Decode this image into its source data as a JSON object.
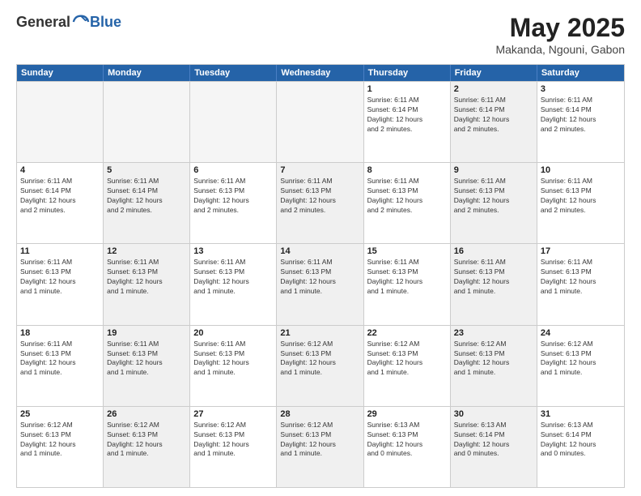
{
  "header": {
    "logo": {
      "general": "General",
      "blue": "Blue"
    },
    "title": "May 2025",
    "location": "Makanda, Ngouni, Gabon"
  },
  "calendar": {
    "days_of_week": [
      "Sunday",
      "Monday",
      "Tuesday",
      "Wednesday",
      "Thursday",
      "Friday",
      "Saturday"
    ],
    "rows": [
      [
        {
          "day": "",
          "empty": true
        },
        {
          "day": "",
          "empty": true
        },
        {
          "day": "",
          "empty": true
        },
        {
          "day": "",
          "empty": true
        },
        {
          "day": "1",
          "info": "Sunrise: 6:11 AM\nSunset: 6:14 PM\nDaylight: 12 hours\nand 2 minutes."
        },
        {
          "day": "2",
          "info": "Sunrise: 6:11 AM\nSunset: 6:14 PM\nDaylight: 12 hours\nand 2 minutes.",
          "shaded": true
        },
        {
          "day": "3",
          "info": "Sunrise: 6:11 AM\nSunset: 6:14 PM\nDaylight: 12 hours\nand 2 minutes."
        }
      ],
      [
        {
          "day": "4",
          "info": "Sunrise: 6:11 AM\nSunset: 6:14 PM\nDaylight: 12 hours\nand 2 minutes."
        },
        {
          "day": "5",
          "info": "Sunrise: 6:11 AM\nSunset: 6:14 PM\nDaylight: 12 hours\nand 2 minutes.",
          "shaded": true
        },
        {
          "day": "6",
          "info": "Sunrise: 6:11 AM\nSunset: 6:13 PM\nDaylight: 12 hours\nand 2 minutes."
        },
        {
          "day": "7",
          "info": "Sunrise: 6:11 AM\nSunset: 6:13 PM\nDaylight: 12 hours\nand 2 minutes.",
          "shaded": true
        },
        {
          "day": "8",
          "info": "Sunrise: 6:11 AM\nSunset: 6:13 PM\nDaylight: 12 hours\nand 2 minutes."
        },
        {
          "day": "9",
          "info": "Sunrise: 6:11 AM\nSunset: 6:13 PM\nDaylight: 12 hours\nand 2 minutes.",
          "shaded": true
        },
        {
          "day": "10",
          "info": "Sunrise: 6:11 AM\nSunset: 6:13 PM\nDaylight: 12 hours\nand 2 minutes."
        }
      ],
      [
        {
          "day": "11",
          "info": "Sunrise: 6:11 AM\nSunset: 6:13 PM\nDaylight: 12 hours\nand 1 minute."
        },
        {
          "day": "12",
          "info": "Sunrise: 6:11 AM\nSunset: 6:13 PM\nDaylight: 12 hours\nand 1 minute.",
          "shaded": true
        },
        {
          "day": "13",
          "info": "Sunrise: 6:11 AM\nSunset: 6:13 PM\nDaylight: 12 hours\nand 1 minute."
        },
        {
          "day": "14",
          "info": "Sunrise: 6:11 AM\nSunset: 6:13 PM\nDaylight: 12 hours\nand 1 minute.",
          "shaded": true
        },
        {
          "day": "15",
          "info": "Sunrise: 6:11 AM\nSunset: 6:13 PM\nDaylight: 12 hours\nand 1 minute."
        },
        {
          "day": "16",
          "info": "Sunrise: 6:11 AM\nSunset: 6:13 PM\nDaylight: 12 hours\nand 1 minute.",
          "shaded": true
        },
        {
          "day": "17",
          "info": "Sunrise: 6:11 AM\nSunset: 6:13 PM\nDaylight: 12 hours\nand 1 minute."
        }
      ],
      [
        {
          "day": "18",
          "info": "Sunrise: 6:11 AM\nSunset: 6:13 PM\nDaylight: 12 hours\nand 1 minute."
        },
        {
          "day": "19",
          "info": "Sunrise: 6:11 AM\nSunset: 6:13 PM\nDaylight: 12 hours\nand 1 minute.",
          "shaded": true
        },
        {
          "day": "20",
          "info": "Sunrise: 6:11 AM\nSunset: 6:13 PM\nDaylight: 12 hours\nand 1 minute."
        },
        {
          "day": "21",
          "info": "Sunrise: 6:12 AM\nSunset: 6:13 PM\nDaylight: 12 hours\nand 1 minute.",
          "shaded": true
        },
        {
          "day": "22",
          "info": "Sunrise: 6:12 AM\nSunset: 6:13 PM\nDaylight: 12 hours\nand 1 minute."
        },
        {
          "day": "23",
          "info": "Sunrise: 6:12 AM\nSunset: 6:13 PM\nDaylight: 12 hours\nand 1 minute.",
          "shaded": true
        },
        {
          "day": "24",
          "info": "Sunrise: 6:12 AM\nSunset: 6:13 PM\nDaylight: 12 hours\nand 1 minute."
        }
      ],
      [
        {
          "day": "25",
          "info": "Sunrise: 6:12 AM\nSunset: 6:13 PM\nDaylight: 12 hours\nand 1 minute."
        },
        {
          "day": "26",
          "info": "Sunrise: 6:12 AM\nSunset: 6:13 PM\nDaylight: 12 hours\nand 1 minute.",
          "shaded": true
        },
        {
          "day": "27",
          "info": "Sunrise: 6:12 AM\nSunset: 6:13 PM\nDaylight: 12 hours\nand 1 minute."
        },
        {
          "day": "28",
          "info": "Sunrise: 6:12 AM\nSunset: 6:13 PM\nDaylight: 12 hours\nand 1 minute.",
          "shaded": true
        },
        {
          "day": "29",
          "info": "Sunrise: 6:13 AM\nSunset: 6:13 PM\nDaylight: 12 hours\nand 0 minutes."
        },
        {
          "day": "30",
          "info": "Sunrise: 6:13 AM\nSunset: 6:14 PM\nDaylight: 12 hours\nand 0 minutes.",
          "shaded": true
        },
        {
          "day": "31",
          "info": "Sunrise: 6:13 AM\nSunset: 6:14 PM\nDaylight: 12 hours\nand 0 minutes."
        }
      ]
    ]
  }
}
